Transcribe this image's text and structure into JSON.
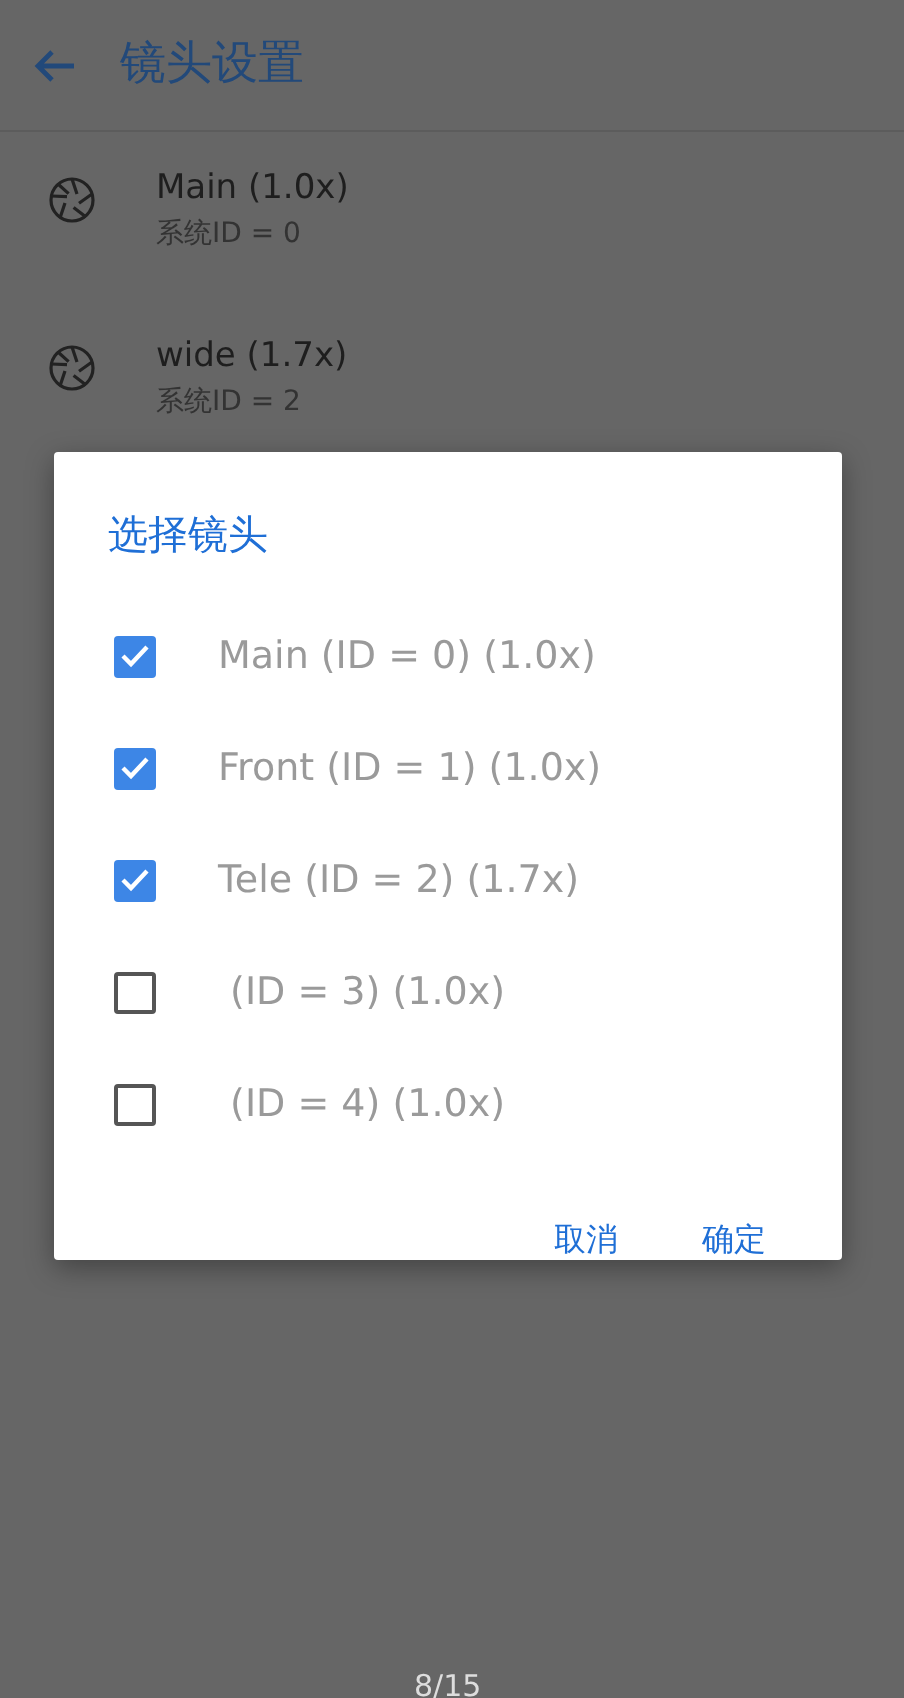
{
  "app_bar": {
    "title": "镜头设置"
  },
  "lenses": [
    {
      "name": "Main (1.0x)",
      "detail": "系统ID = 0"
    },
    {
      "name": "wide (1.7x)",
      "detail": "系统ID = 2"
    }
  ],
  "dialog": {
    "title": "选择镜头",
    "options": [
      {
        "label": "Main (ID = 0) (1.0x)",
        "checked": true
      },
      {
        "label": "Front (ID = 1) (1.0x)",
        "checked": true
      },
      {
        "label": "Tele (ID = 2) (1.7x)",
        "checked": true
      },
      {
        "label": " (ID = 3) (1.0x)",
        "checked": false
      },
      {
        "label": " (ID = 4) (1.0x)",
        "checked": false
      }
    ],
    "buttons": [
      "取消",
      "确定"
    ]
  },
  "page_counter": "8/15"
}
